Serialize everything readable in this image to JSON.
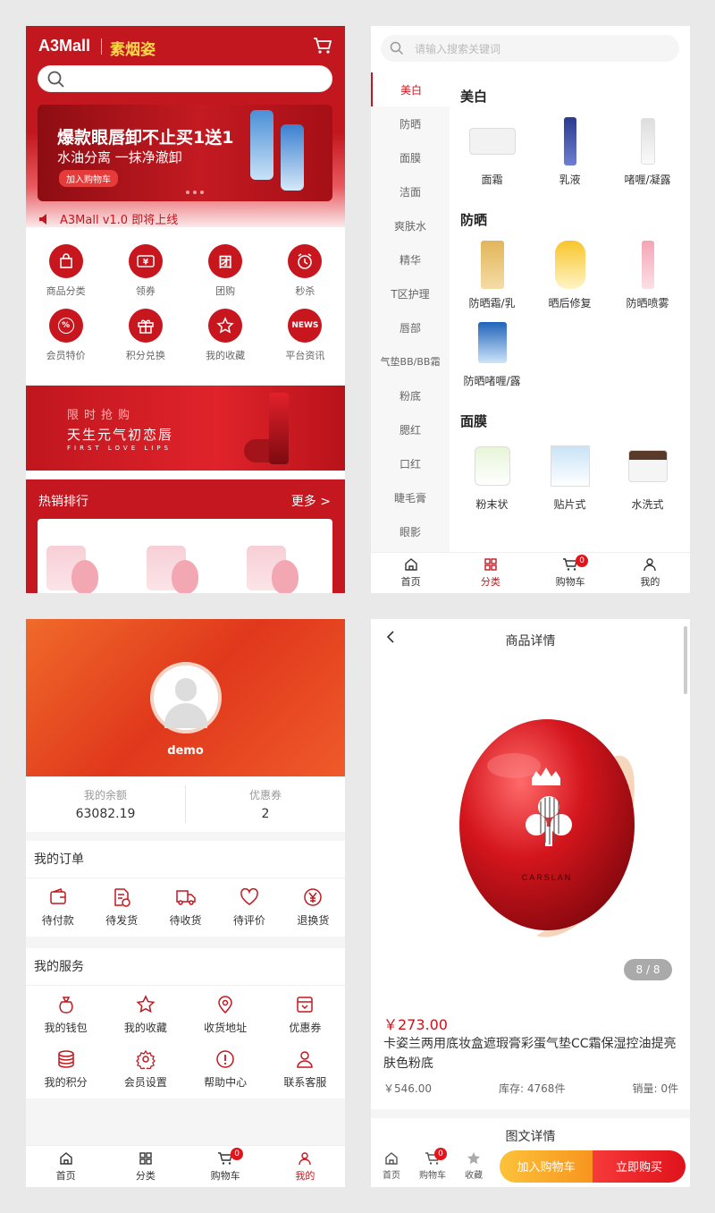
{
  "home": {
    "logo": "A3Mall",
    "logo_sub": "素烟姿",
    "banner": {
      "title": "爆款眼唇卸不止买1送1",
      "subtitle": "水油分离 一抹净澈卸",
      "button": "加入购物车"
    },
    "notice": "A3Mall v1.0 即将上线",
    "grid": [
      {
        "label": "商品分类",
        "icon": "bag-icon"
      },
      {
        "label": "领券",
        "icon": "coupon-icon"
      },
      {
        "label": "团购",
        "icon": "group-icon",
        "glyph": "团"
      },
      {
        "label": "秒杀",
        "icon": "clock-icon"
      },
      {
        "label": "会员特价",
        "icon": "percent-icon",
        "glyph": "%"
      },
      {
        "label": "积分兑换",
        "icon": "gift-icon"
      },
      {
        "label": "我的收藏",
        "icon": "star-icon"
      },
      {
        "label": "平台资讯",
        "icon": "news-icon",
        "glyph": "NEWS"
      }
    ],
    "promo": {
      "line1": "限时抢购",
      "line2": "天生元气初恋唇",
      "line3": "FIRST LOVE LIPS"
    },
    "hot": {
      "title": "热销排行",
      "more": "更多 >"
    }
  },
  "category": {
    "search_placeholder": "请输入搜索关键词",
    "sidebar": [
      "美白",
      "防晒",
      "面膜",
      "洁面",
      "爽肤水",
      "精华",
      "T区护理",
      "唇部",
      "气垫BB/BB霜",
      "粉底",
      "腮红",
      "口红",
      "睫毛膏",
      "眼影"
    ],
    "sections": [
      {
        "title": "美白",
        "items": [
          "面霜",
          "乳液",
          "啫喱/凝露"
        ]
      },
      {
        "title": "防晒",
        "items": [
          "防晒霜/乳",
          "晒后修复",
          "防晒喷雾",
          "防晒啫喱/露"
        ]
      },
      {
        "title": "面膜",
        "items": [
          "粉末状",
          "贴片式",
          "水洗式"
        ]
      }
    ]
  },
  "tabbar": [
    {
      "label": "首页",
      "icon": "home-icon"
    },
    {
      "label": "分类",
      "icon": "category-icon"
    },
    {
      "label": "购物车",
      "icon": "cart-icon",
      "badge": "0"
    },
    {
      "label": "我的",
      "icon": "user-icon"
    }
  ],
  "mine": {
    "username": "demo",
    "balance_label": "我的余额",
    "balance": "63082.19",
    "coupon_label": "优惠券",
    "coupon": "2",
    "orders_title": "我的订单",
    "orders": [
      {
        "label": "待付款",
        "icon": "wallet-icon"
      },
      {
        "label": "待发货",
        "icon": "document-clock-icon"
      },
      {
        "label": "待收货",
        "icon": "truck-icon"
      },
      {
        "label": "待评价",
        "icon": "heart-icon"
      },
      {
        "label": "退换货",
        "icon": "yen-circle-icon"
      }
    ],
    "services_title": "我的服务",
    "services": [
      {
        "label": "我的钱包",
        "icon": "money-bag-icon"
      },
      {
        "label": "我的收藏",
        "icon": "star-icon"
      },
      {
        "label": "收货地址",
        "icon": "location-icon"
      },
      {
        "label": "优惠券",
        "icon": "coupon-icon"
      },
      {
        "label": "我的积分",
        "icon": "coins-icon"
      },
      {
        "label": "会员设置",
        "icon": "gear-icon"
      },
      {
        "label": "帮助中心",
        "icon": "help-icon"
      },
      {
        "label": "联系客服",
        "icon": "service-icon"
      }
    ]
  },
  "detail": {
    "title": "商品详情",
    "pager": "8 / 8",
    "price": "￥273.00",
    "name": "卡姿兰两用底妆盒遮瑕膏彩蛋气垫CC霜保湿控油提亮肤色粉底",
    "original_price": "￥546.00",
    "stock": "库存: 4768件",
    "sales": "销量: 0件",
    "section": "图文详情",
    "bar": [
      {
        "label": "首页",
        "icon": "home-icon"
      },
      {
        "label": "购物车",
        "icon": "cart-icon",
        "badge": "0"
      },
      {
        "label": "收藏",
        "icon": "star-icon"
      }
    ],
    "add_cart": "加入购物车",
    "buy_now": "立即购买",
    "brand": "CARSLAN"
  },
  "colors": {
    "primary": "#c3171f",
    "accent": "#ffd84a",
    "orange": "#f7951e"
  }
}
